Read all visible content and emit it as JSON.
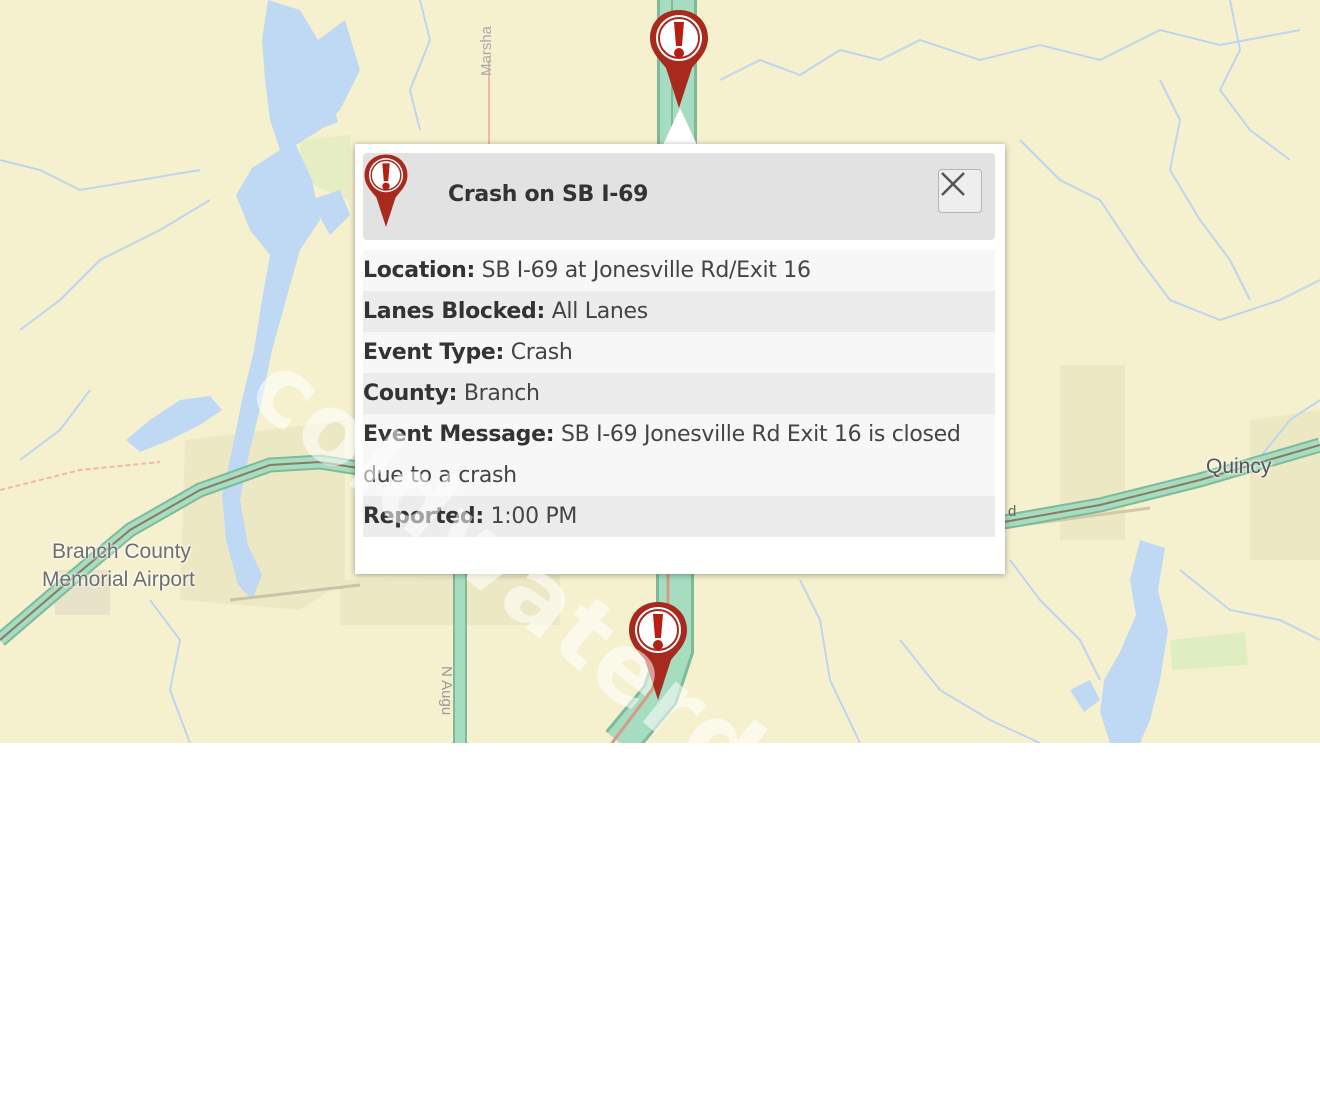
{
  "map": {
    "place_labels": {
      "airport_line1": "Branch County",
      "airport_line2": "Memorial Airport",
      "town": "Quincy"
    },
    "road_labels": {
      "north_road": "Marsha",
      "south_road": "N Augu",
      "east_fragment": "d"
    },
    "colors": {
      "land": "#f5f1cf",
      "water": "#bfd9f5",
      "highway": "#9fd8b8",
      "incident_marker": "#a82a1e"
    },
    "markers": [
      {
        "type": "crash",
        "icon": "exclamation-marker-icon"
      },
      {
        "type": "crash",
        "icon": "exclamation-marker-icon"
      }
    ]
  },
  "popup": {
    "icon": "exclamation-marker-icon",
    "title": "Crash on SB I-69",
    "close_icon": "close-icon",
    "details": {
      "location_label": "Location:",
      "location_value": "SB I-69 at Jonesville Rd/Exit 16",
      "lanes_label": "Lanes Blocked:",
      "lanes_value": "All Lanes",
      "event_type_label": "Event Type:",
      "event_type_value": "Crash",
      "county_label": "County:",
      "county_value": "Branch",
      "message_label": "Event Message:",
      "message_value": "SB I-69 Jonesville Rd Exit 16 is closed due to a crash",
      "reported_label": "Reported:",
      "reported_value": "1:00 PM"
    }
  },
  "watermark": "coldwaterdaily.com"
}
